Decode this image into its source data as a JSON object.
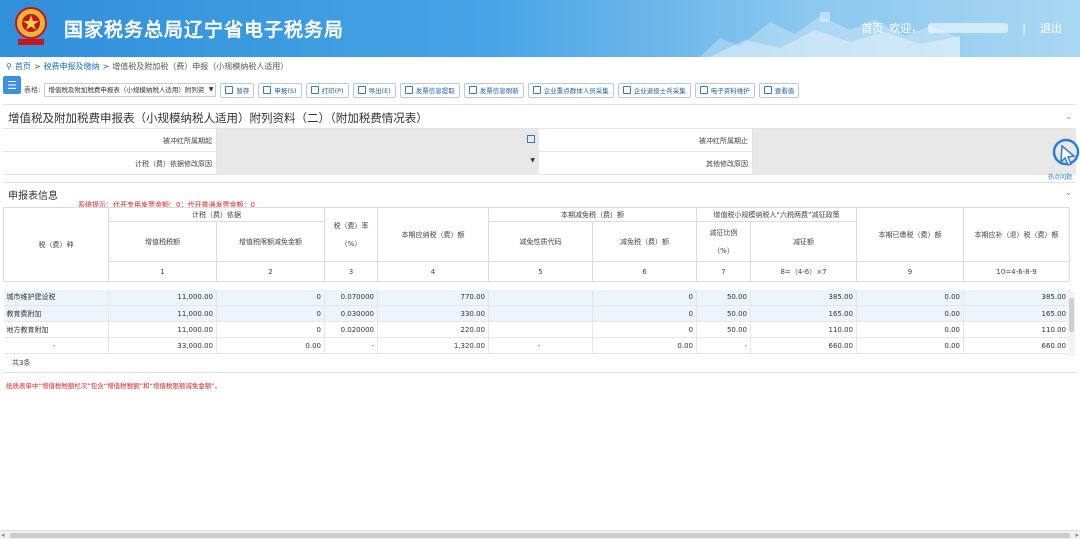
{
  "header": {
    "title": "国家税务总局辽宁省电子税务局",
    "nav_home": "首页",
    "nav_welcome": "欢迎，",
    "nav_sep": "|",
    "nav_exit": "退出",
    "brand_color": "#2f8fd9"
  },
  "breadcrumb": {
    "home": "首页",
    "sep": ">",
    "level1": "税费申报及缴纳",
    "level2": "增值税及附加税（费）申报（小规模纳税人适用）"
  },
  "toolbar": {
    "menu_icon": "menu-icon",
    "form_label": "表格:",
    "form_select": "增值税及附加税费申报表（小规模纳税人适用）附列资",
    "buttons": [
      {
        "label": "暂存",
        "icon": "save-icon"
      },
      {
        "label": "申报(S)",
        "icon": "declare-icon"
      },
      {
        "label": "打印(P)",
        "icon": "print-icon"
      },
      {
        "label": "导出(E)",
        "icon": "export-icon"
      },
      {
        "label": "发票信息提取",
        "icon": "invoice-icon"
      },
      {
        "label": "发票信息刷新",
        "icon": "refresh-icon"
      },
      {
        "label": "企业重点群体人员采集",
        "icon": "edit-icon"
      },
      {
        "label": "企业退役士兵采集",
        "icon": "edit-icon"
      },
      {
        "label": "电子资料维护",
        "icon": "edit-icon"
      },
      {
        "label": "查看值",
        "icon": "search-icon"
      }
    ]
  },
  "form_panel": {
    "title": "增值税及附加税费申报表（小规模纳税人适用）附列资料（二）（附加税费情况表）",
    "fields": [
      {
        "label": "被冲红所属期起",
        "value": ""
      },
      {
        "label": "被冲红所属期止",
        "value": ""
      },
      {
        "label": "计税（费）依据修改原因",
        "value": ""
      },
      {
        "label": "其他修改原因",
        "value": ""
      }
    ]
  },
  "float_tool": {
    "label": "热点问题"
  },
  "table_panel": {
    "title": "申报表信息",
    "hint": "系统提示：代开专用发票金额：0；代开普通发票金额：0",
    "headers": {
      "tax_type": "税（费）种",
      "basis": "计税（费）依据",
      "basis_vat": "增值税税额",
      "basis_limit": "增值税限额减免金额",
      "rate": "税（费）率",
      "rate_unit": "（%）",
      "payable": "本期应纳税（费）额",
      "reduction": "本期减免税（费）额",
      "reduce_code": "减免性质代码",
      "reduce_amount": "减免税（费）额",
      "six_tax": "增值税小规模纳税人“六税两费”减征政策",
      "six_ratio": "减征比例",
      "six_ratio_unit": "（%）",
      "six_amount": "减征额",
      "paid": "本期已缴税（费）额",
      "refund": "本期应补（退）税（费）额"
    },
    "col_numbers": [
      "1",
      "2",
      "3",
      "4",
      "5",
      "6",
      "7",
      "8=（4-6）×7",
      "9",
      "10=4-6-8-9"
    ],
    "rows": [
      {
        "name": "城市维护建设税",
        "c1": "11,000.00",
        "c2": "0",
        "c3": "0.070000",
        "c4": "770.00",
        "c5": "",
        "c6": "0",
        "c7": "50.00",
        "c8": "385.00",
        "c9": "0.00",
        "c10": "385.00"
      },
      {
        "name": "教育费附加",
        "c1": "11,000.00",
        "c2": "0",
        "c3": "0.030000",
        "c4": "330.00",
        "c5": "",
        "c6": "0",
        "c7": "50.00",
        "c8": "165.00",
        "c9": "0.00",
        "c10": "165.00"
      },
      {
        "name": "地方教育附加",
        "c1": "11,000.00",
        "c2": "0",
        "c3": "0.020000",
        "c4": "220.00",
        "c5": "",
        "c6": "0",
        "c7": "50.00",
        "c8": "110.00",
        "c9": "0.00",
        "c10": "110.00"
      }
    ],
    "total": {
      "name": "-",
      "c1": "33,000.00",
      "c2": "0.00",
      "c3": "-",
      "c4": "1,320.00",
      "c5": "-",
      "c6": "0.00",
      "c7": "-",
      "c8": "660.00",
      "c9": "0.00",
      "c10": "660.00"
    },
    "count": "共3条",
    "error": "纸质表单中“增值税税额栏次”包含“增值税税额”和“增值税限额减免金额”。"
  }
}
